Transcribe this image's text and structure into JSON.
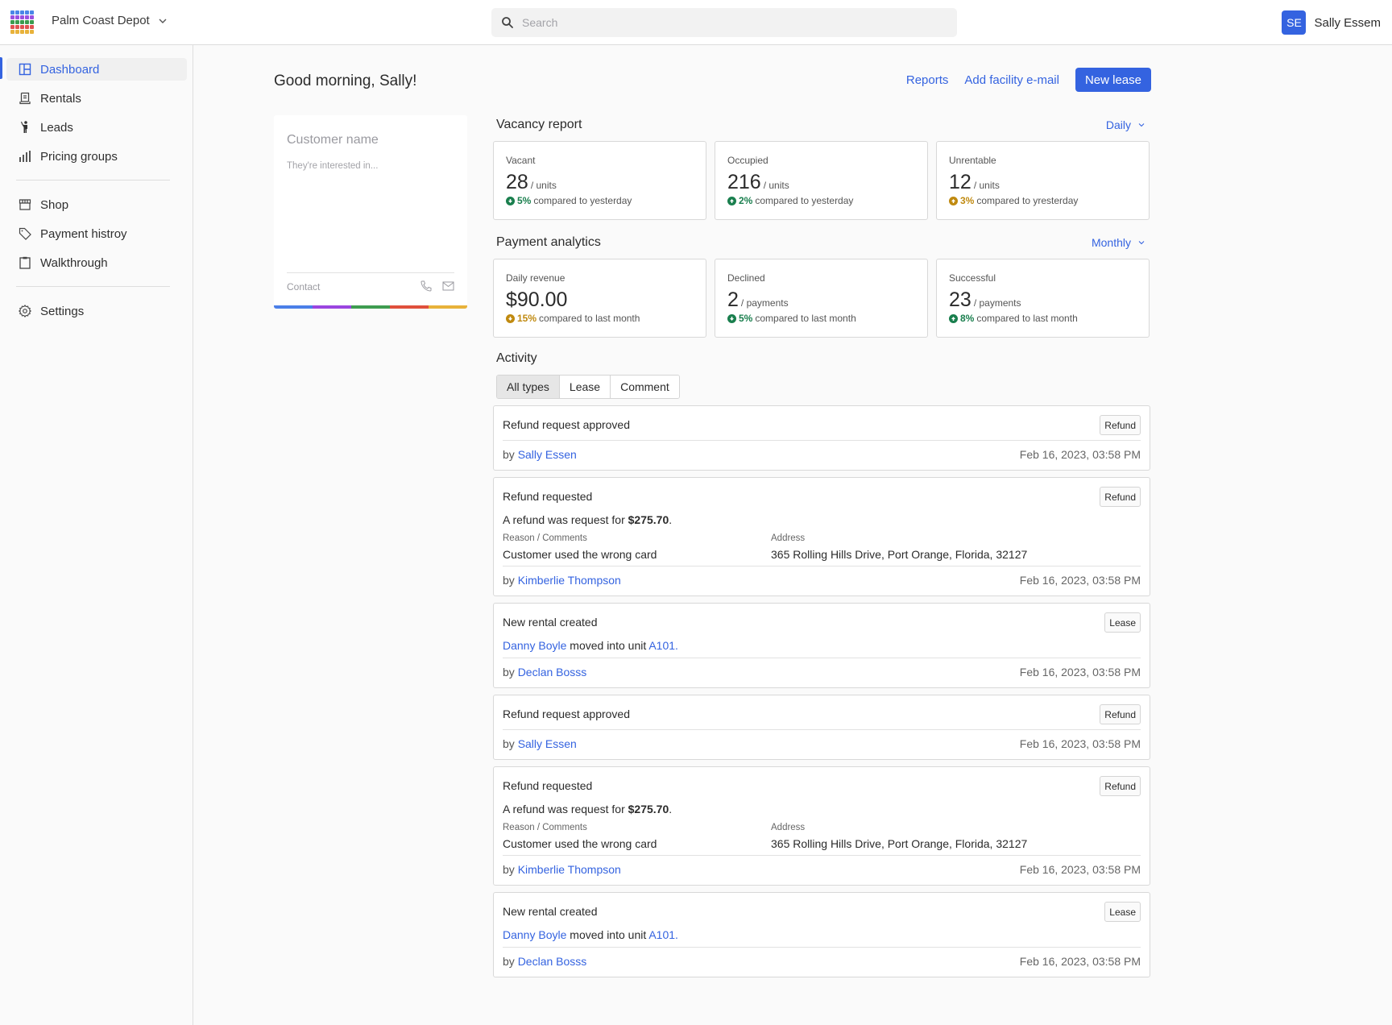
{
  "topbar": {
    "facility_name": "Palm Coast Depot",
    "search_placeholder": "Search",
    "user_initials": "SE",
    "user_name": "Sally Essem",
    "app_grid_colors": [
      "#4a86e8",
      "#9b51e0",
      "#3a9c4f",
      "#e05252",
      "#e8b23a"
    ]
  },
  "sidebar": {
    "items": [
      {
        "label": "Dashboard",
        "icon": "layout-icon",
        "active": true
      },
      {
        "label": "Rentals",
        "icon": "receipt-icon"
      },
      {
        "label": "Leads",
        "icon": "person-waving-icon"
      },
      {
        "label": "Pricing groups",
        "icon": "bar-chart-icon"
      },
      {
        "label": "Shop",
        "icon": "storefront-icon"
      },
      {
        "label": "Payment histroy",
        "icon": "tag-icon"
      },
      {
        "label": "Walkthrough",
        "icon": "clipboard-icon"
      },
      {
        "label": "Settings",
        "icon": "gear-icon"
      }
    ]
  },
  "header": {
    "greeting": "Good morning, Sally!",
    "reports_label": "Reports",
    "add_email_label": "Add facility e-mail",
    "new_lease_label": "New lease"
  },
  "customer_card": {
    "name_placeholder": "Customer name",
    "interest_placeholder": "They're interested in...",
    "contact_label": "Contact",
    "rainbow_colors": [
      "#4a7fe8",
      "#9b45e0",
      "#3f9c50",
      "#e0503c",
      "#e8b23a"
    ]
  },
  "vacancy": {
    "title": "Vacancy report",
    "period": "Daily",
    "cards": [
      {
        "label": "Vacant",
        "value": "28",
        "unit": "/ units",
        "pct": "5%",
        "direction": "down",
        "status": "good",
        "comparison": "compared to yesterday"
      },
      {
        "label": "Occupied",
        "value": "216",
        "unit": "/ units",
        "pct": "2%",
        "direction": "up",
        "status": "good",
        "comparison": "compared to yesterday"
      },
      {
        "label": "Unrentable",
        "value": "12",
        "unit": "/ units",
        "pct": "3%",
        "direction": "up",
        "status": "warn",
        "comparison": "compared to yresterday"
      }
    ]
  },
  "payments": {
    "title": "Payment analytics",
    "period": "Monthly",
    "cards": [
      {
        "label": "Daily revenue",
        "value": "$90.00",
        "unit": "",
        "pct": "15%",
        "direction": "down",
        "status": "warn",
        "comparison": "compared to last month"
      },
      {
        "label": "Declined",
        "value": "2",
        "unit": "/ payments",
        "pct": "5%",
        "direction": "down",
        "status": "good",
        "comparison": "compared to last month"
      },
      {
        "label": "Successful",
        "value": "23",
        "unit": "/ payments",
        "pct": "8%",
        "direction": "up",
        "status": "good",
        "comparison": "compared to last month"
      }
    ]
  },
  "colors": {
    "accent": "#3463e0",
    "good": "#1a7f4e",
    "warn": "#c08a10"
  },
  "activity": {
    "title": "Activity",
    "filters": [
      "All types",
      "Lease",
      "Comment"
    ],
    "active_filter": "All types",
    "by_prefix": "by",
    "items": [
      {
        "kind": "simple",
        "title": "Refund request approved",
        "tag": "Refund",
        "by": "Sally Essen",
        "date": "Feb 16, 2023, 03:58 PM"
      },
      {
        "kind": "refund",
        "title": "Refund requested",
        "tag": "Refund",
        "text": "A refund was request for ",
        "amount": "$275.70",
        "reason_label": "Reason / Comments",
        "reason": "Customer used the wrong card",
        "address_label": "Address",
        "address": "365 Rolling Hills Drive, Port Orange, Florida, 32127",
        "by": "Kimberlie Thompson",
        "date": "Feb 16, 2023, 03:58 PM"
      },
      {
        "kind": "rental",
        "title": "New rental created",
        "tag": "Lease",
        "tenant": "Danny Boyle",
        "moved_text": " moved into unit ",
        "unit": "A101.",
        "by": "Declan Bosss",
        "date": "Feb 16, 2023, 03:58 PM"
      },
      {
        "kind": "simple",
        "title": "Refund request approved",
        "tag": "Refund",
        "by": "Sally Essen",
        "date": "Feb 16, 2023, 03:58 PM"
      },
      {
        "kind": "refund",
        "title": "Refund requested",
        "tag": "Refund",
        "text": "A refund was request for ",
        "amount": "$275.70",
        "reason_label": "Reason / Comments",
        "reason": "Customer used the wrong card",
        "address_label": "Address",
        "address": "365 Rolling Hills Drive, Port Orange, Florida, 32127",
        "by": "Kimberlie Thompson",
        "date": "Feb 16, 2023, 03:58 PM"
      },
      {
        "kind": "rental",
        "title": "New rental created",
        "tag": "Lease",
        "tenant": "Danny Boyle",
        "moved_text": " moved into unit ",
        "unit": "A101.",
        "by": "Declan Bosss",
        "date": "Feb 16, 2023, 03:58 PM"
      }
    ]
  }
}
